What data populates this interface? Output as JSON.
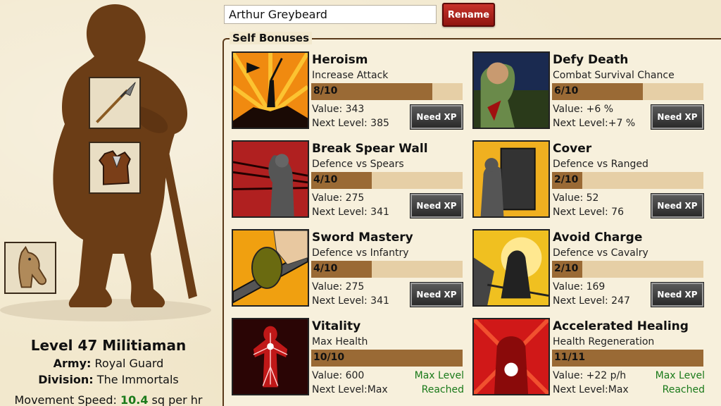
{
  "character": {
    "name_input": "Arthur Greybeard",
    "rename_label": "Rename",
    "title": "Level 47 Militiaman",
    "army_label": "Army:",
    "army_value": "Royal Guard",
    "division_label": "Division:",
    "division_value": "The Immortals",
    "speed_label": "Movement Speed:",
    "speed_value": "10.4",
    "speed_unit": "sq per hr"
  },
  "equipment": [
    "spear-icon",
    "leather-armor-icon",
    "horse-icon"
  ],
  "bonuses": {
    "section_title": "Self Bonuses",
    "need_xp_label": "Need XP",
    "max_level_label": "Max Level",
    "reached_label": "Reached",
    "skills": [
      {
        "title": "Heroism",
        "desc": "Increase Attack",
        "level": "8/10",
        "progress": 0.8,
        "value": "Value: 343",
        "next": "Next Level: 385",
        "maxed": false
      },
      {
        "title": "Defy Death",
        "desc": "Combat Survival Chance",
        "level": "6/10",
        "progress": 0.6,
        "value": "Value: +6 %",
        "next": "Next Level:+7 %",
        "maxed": false
      },
      {
        "title": "Break Spear Wall",
        "desc": "Defence vs Spears",
        "level": "4/10",
        "progress": 0.4,
        "value": "Value: 275",
        "next": "Next Level: 341",
        "maxed": false
      },
      {
        "title": "Cover",
        "desc": "Defence vs Ranged",
        "level": "2/10",
        "progress": 0.2,
        "value": "Value: 52",
        "next": "Next Level: 76",
        "maxed": false
      },
      {
        "title": "Sword Mastery",
        "desc": "Defence vs Infantry",
        "level": "4/10",
        "progress": 0.4,
        "value": "Value: 275",
        "next": "Next Level: 341",
        "maxed": false
      },
      {
        "title": "Avoid Charge",
        "desc": "Defence vs Cavalry",
        "level": "2/10",
        "progress": 0.2,
        "value": "Value: 169",
        "next": "Next Level: 247",
        "maxed": false
      },
      {
        "title": "Vitality",
        "desc": "Max Health",
        "level": "10/10",
        "progress": 1.0,
        "value": "Value: 600",
        "next": "Next Level:Max",
        "maxed": true
      },
      {
        "title": "Accelerated Healing",
        "desc": "Health Regeneration",
        "level": "11/11",
        "progress": 1.0,
        "value": "Value: +22 p/h",
        "next": "Next Level:Max",
        "maxed": true
      }
    ]
  },
  "colors": {
    "bar_fill": "#9a6a35",
    "bar_bg": "#e6cfa6",
    "max_text": "#1a7a1a",
    "rename_bg": "#b0201a"
  }
}
